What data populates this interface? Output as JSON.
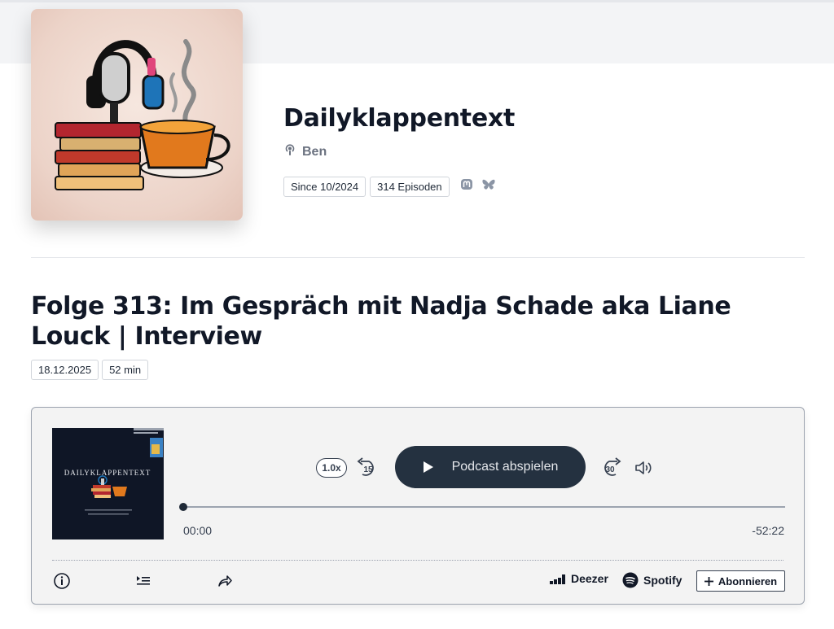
{
  "podcast": {
    "title": "Dailyklappentext",
    "author": "Ben",
    "since": "Since 10/2024",
    "episodes": "314 Episoden",
    "social_icons": [
      "mastodon-icon",
      "bluesky-icon"
    ]
  },
  "episode": {
    "title": "Folge 313: Im Gespräch mit Nadja Schade aka Liane Louck | Interview",
    "date": "18.12.2025",
    "duration": "52 min"
  },
  "player": {
    "speed": "1.0x",
    "skip_back": "15",
    "skip_forward": "30",
    "play_label": "Podcast abspielen",
    "time_current": "00:00",
    "time_remaining": "-52:22",
    "progress": 0,
    "thumb_title": "DAILYKLAPPENTEXT",
    "deezer_label": "Deezer",
    "spotify_label": "Spotify",
    "subscribe_label": "Abonnieren"
  },
  "colors": {
    "play_button": "#243140",
    "title_text": "#111827",
    "muted_text": "#6b7280"
  }
}
